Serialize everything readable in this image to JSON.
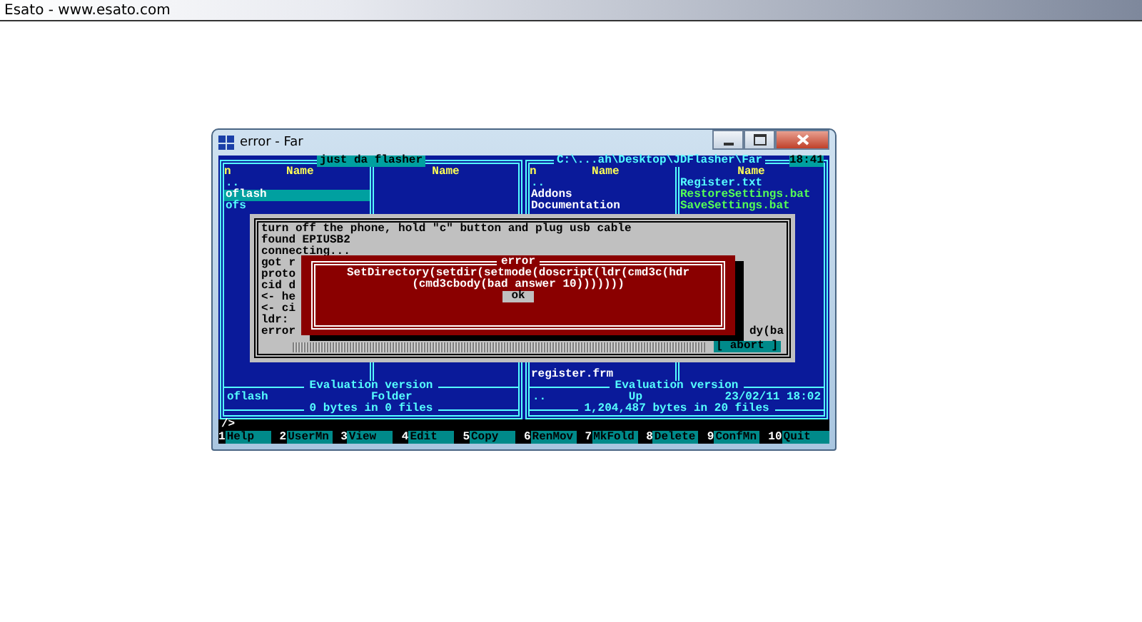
{
  "browser_title": "Esato - www.esato.com",
  "window": {
    "title": "error - Far"
  },
  "left_panel": {
    "title": "just da flasher",
    "columns": [
      {
        "header": "Name",
        "files": [
          {
            "name": "..",
            "selected": false,
            "color": "#55ffff"
          },
          {
            "name": "oflash",
            "selected": true
          },
          {
            "name": "ofs",
            "selected": false,
            "color": "#55ffff"
          }
        ]
      },
      {
        "header": "Name"
      }
    ],
    "index_header": "n",
    "footer_label": "Evaluation version",
    "info_name": "oflash",
    "info_type": "Folder",
    "summary": "0 bytes in 0 files"
  },
  "right_panel": {
    "title": "C:\\...ah\\Desktop\\JDFlasher\\Far",
    "clock": "18:41",
    "columns": [
      {
        "header": "Name",
        "files": [
          {
            "name": "..",
            "selected": false,
            "color": "#55ffff"
          },
          {
            "name": "Addons",
            "selected": false,
            "color": "#ffffff"
          },
          {
            "name": "Documentation",
            "selected": false,
            "color": "#ffffff"
          }
        ]
      },
      {
        "header": "Name",
        "files": [
          {
            "name": "Register.txt",
            "selected": false,
            "color": "#55ffff"
          },
          {
            "name": "RestoreSettings.bat",
            "selected": false,
            "color": "#55ff55"
          },
          {
            "name": "SaveSettings.bat",
            "selected": false,
            "color": "#55ff55"
          }
        ]
      }
    ],
    "bottom_file": "register.frm",
    "index_header": "n",
    "footer_label": "Evaluation version",
    "info_name": "..",
    "info_type": "Up",
    "info_date": "23/02/11 18:02",
    "summary": "1,204,487 bytes in 20 files"
  },
  "progress_dialog": {
    "lines": [
      "turn off the phone, hold \"c\" button and plug usb cable",
      "found EPIUSB2",
      "connecting...",
      "got r",
      "proto",
      "cid d",
      "<- he",
      "<- ci",
      "ldr:",
      "error"
    ],
    "right_fragment": "dy(ba",
    "level": 1,
    "button": "[ abort ]"
  },
  "error_dialog": {
    "title": "error",
    "message_lines": [
      "SetDirectory(setdir(setmode(doscript(ldr(cmd3c(hdr",
      "(cmd3cbody(bad answer 10)))))))"
    ],
    "button": "ok"
  },
  "command_line": "/>",
  "keybar": [
    {
      "num": "1",
      "label": "Help"
    },
    {
      "num": "2",
      "label": "UserMn"
    },
    {
      "num": "3",
      "label": "View"
    },
    {
      "num": "4",
      "label": "Edit"
    },
    {
      "num": "5",
      "label": "Copy"
    },
    {
      "num": "6",
      "label": "RenMov"
    },
    {
      "num": "7",
      "label": "MkFold"
    },
    {
      "num": "8",
      "label": "Delete"
    },
    {
      "num": "9",
      "label": "ConfMn"
    },
    {
      "num": "10",
      "label": "Quit"
    }
  ]
}
